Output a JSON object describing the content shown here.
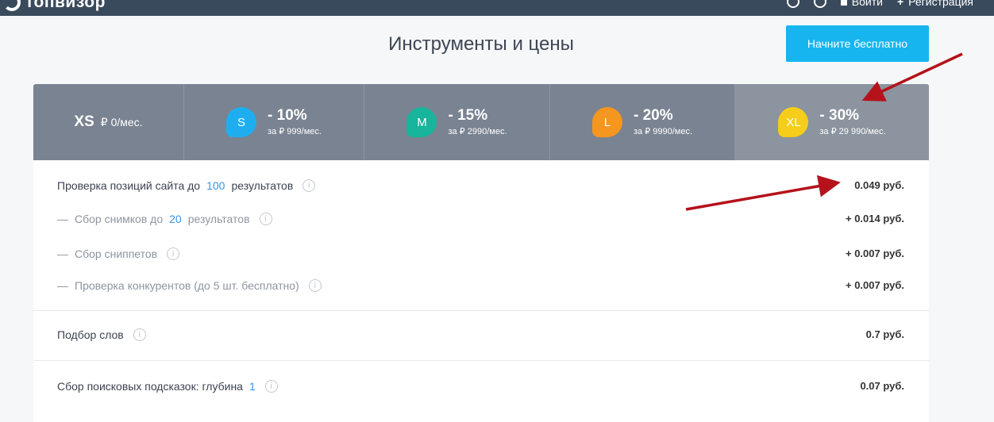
{
  "topbar": {
    "logo_text": "топвизор",
    "login_label": "Войти",
    "register_label": "Регистрация"
  },
  "header": {
    "title": "Инструменты и цены",
    "start_button": "Начните бесплатно"
  },
  "plans": [
    {
      "name": "XS",
      "price": "₽ 0/мес."
    },
    {
      "name": "S",
      "discount": "- 10%",
      "price": "за ₽ 999/мес.",
      "color": "#1eaef0"
    },
    {
      "name": "M",
      "discount": "- 15%",
      "price": "за ₽ 2990/мес.",
      "color": "#18b49b"
    },
    {
      "name": "L",
      "discount": "- 20%",
      "price": "за ₽ 9990/мес.",
      "color": "#f5961e"
    },
    {
      "name": "XL",
      "discount": "- 30%",
      "price": "за ₽ 29 990/мес.",
      "color": "#f5cd1a"
    }
  ],
  "rows": [
    {
      "prefix": "Проверка позиций сайта до",
      "num": "100",
      "suffix": "результатов",
      "price": "0.049 руб."
    },
    {
      "dash": "—",
      "prefix": "Сбор снимков до",
      "num": "20",
      "suffix": "результатов",
      "price": "+ 0.014 руб."
    },
    {
      "dash": "—",
      "prefix": "Сбор сниппетов",
      "price": "+ 0.007 руб."
    },
    {
      "dash": "—",
      "prefix": "Проверка конкурентов (до 5 шт. бесплатно)",
      "price": "+ 0.007 руб."
    },
    {
      "prefix": "Подбор слов",
      "price": "0.7 руб."
    },
    {
      "prefix": "Сбор поисковых подсказок: глубина",
      "num": "1",
      "price": "0.07 руб."
    }
  ],
  "info_glyph": "i"
}
